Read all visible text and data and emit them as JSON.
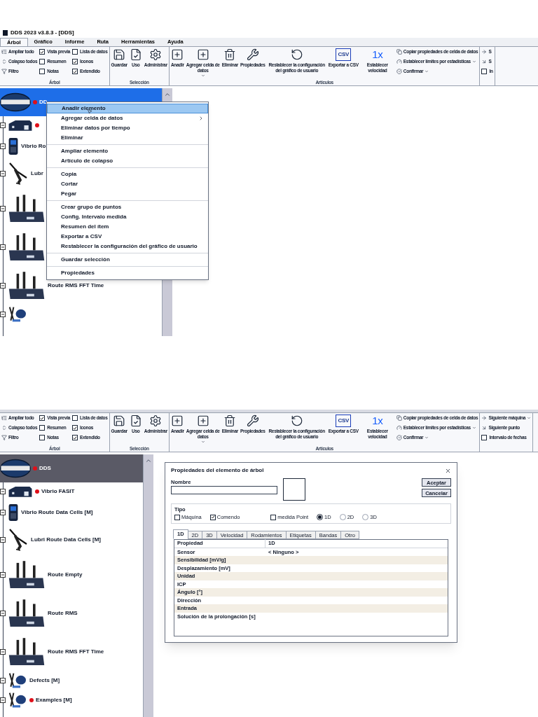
{
  "screens": [
    {
      "title": "DDS 2023 v3.8.3 - [DDS]",
      "tabs": [
        {
          "label": "Árbol",
          "selected": true
        },
        {
          "label": "Gráfico",
          "selected": false
        },
        {
          "label": "Informe",
          "selected": false
        },
        {
          "label": "Ruta",
          "selected": false
        },
        {
          "label": "Herramientas",
          "selected": false
        },
        {
          "label": "Ayuda",
          "selected": false
        }
      ],
      "ribbon": [
        {
          "label": "Árbol",
          "columns": [
            [
              {
                "kind": "small",
                "label": "Ampliar todo"
              },
              {
                "kind": "small",
                "label": "Colapso todos"
              },
              {
                "kind": "small",
                "label": "Filtro"
              }
            ],
            [
              {
                "kind": "check",
                "label": "Vista previa",
                "checked": true
              },
              {
                "kind": "check",
                "label": "Resumen",
                "checked": false
              },
              {
                "kind": "check",
                "label": "Notas",
                "checked": false
              }
            ],
            [
              {
                "kind": "check",
                "label": "Lista de datos",
                "checked": false
              },
              {
                "kind": "check",
                "label": "Iconos",
                "checked": true
              },
              {
                "kind": "check",
                "label": "Extendido",
                "checked": true
              }
            ]
          ]
        },
        {
          "label": "Selección",
          "columns": [
            [
              {
                "kind": "large",
                "label": "Guardar"
              }
            ],
            [
              {
                "kind": "large",
                "label": "Uso"
              }
            ],
            [
              {
                "kind": "large",
                "label": "Administrar"
              }
            ]
          ]
        },
        {
          "label": "Artículos",
          "columns": [
            [
              {
                "kind": "large",
                "label": "Anadir"
              }
            ],
            [
              {
                "kind": "large",
                "label": "Agregar celda de datos",
                "menu": true
              }
            ],
            [
              {
                "kind": "large",
                "label": "Eliminar"
              }
            ],
            [
              {
                "kind": "large",
                "label": "Propiedades"
              }
            ],
            [
              {
                "kind": "large",
                "label": "Restablecer la configuración del gráfico de usuario"
              }
            ],
            [
              {
                "kind": "large",
                "label": "Exportar a CSV",
                "glyph": "CSV"
              }
            ],
            [
              {
                "kind": "large",
                "label": "Establecer velocidad",
                "glyph": "1x"
              }
            ],
            [
              {
                "kind": "small",
                "label": "Copiar propiedades de celda de datos"
              },
              {
                "kind": "small",
                "label": "Establecer límites por estadísticas",
                "menu": true
              },
              {
                "kind": "small",
                "label": "Confirmar",
                "menu": true
              }
            ]
          ]
        },
        {
          "columns": [
            [
              {
                "kind": "small",
                "label": "S"
              },
              {
                "kind": "small",
                "label": "S"
              },
              {
                "kind": "check",
                "label": "In",
                "checked": false
              }
            ]
          ]
        }
      ],
      "tree_focused": true,
      "tree": [
        {
          "kind": "root",
          "label": "DD",
          "alarm": true,
          "selected": true
        },
        {
          "kind": "building",
          "alarm": true,
          "selected": false
        },
        {
          "kind": "device",
          "label": "Vibrio Ro",
          "alarm": false,
          "selected": false
        },
        {
          "kind": "lubricator",
          "label": "Lubr",
          "alarm": false,
          "selected": false
        },
        {
          "kind": "router",
          "alarm": false,
          "selected": false
        },
        {
          "kind": "router",
          "alarm": false,
          "selected": false
        },
        {
          "kind": "router",
          "label": "Route RMS FFT Time",
          "alarm": false,
          "selected": false
        },
        {
          "kind": "defects",
          "alarm": false,
          "selected": false
        }
      ],
      "context_menu": [
        [
          {
            "label": "Anadir elemento",
            "highlighted": true,
            "submenu": false
          },
          {
            "label": "Agregar celda de datos",
            "highlighted": false,
            "submenu": true
          },
          {
            "label": "Eliminar datos por tiempo",
            "highlighted": false,
            "submenu": false
          },
          {
            "label": "Eliminar",
            "highlighted": false,
            "submenu": false
          }
        ],
        [
          {
            "label": "Ampliar elemento",
            "highlighted": false,
            "submenu": false
          },
          {
            "label": "Artículo de colapso",
            "highlighted": false,
            "submenu": false
          }
        ],
        [
          {
            "label": "Copia",
            "highlighted": false,
            "submenu": false
          },
          {
            "label": "Cortar",
            "highlighted": false,
            "submenu": false
          },
          {
            "label": "Pegar",
            "highlighted": false,
            "submenu": false
          }
        ],
        [
          {
            "label": "Crear grupo de puntos",
            "highlighted": false,
            "submenu": false
          },
          {
            "label": "Config. Intervalo medida",
            "highlighted": false,
            "submenu": false
          },
          {
            "label": "Resumen del ítem",
            "highlighted": false,
            "submenu": false
          },
          {
            "label": "Exportar a CSV",
            "highlighted": false,
            "submenu": false
          },
          {
            "label": "Restablecer la configuración del gráfico de usuario",
            "highlighted": false,
            "submenu": false
          }
        ],
        [
          {
            "label": "Guardar selección",
            "highlighted": false,
            "submenu": false
          }
        ],
        [
          {
            "label": "Propiedades",
            "highlighted": false,
            "submenu": false
          }
        ]
      ]
    },
    {
      "ribbon": [
        {
          "label": "Árbol",
          "columns": [
            [
              {
                "kind": "small",
                "label": "Ampliar todo"
              },
              {
                "kind": "small",
                "label": "Colapso todos"
              },
              {
                "kind": "small",
                "label": "Filtro"
              }
            ],
            [
              {
                "kind": "check",
                "label": "Vista previa",
                "checked": true
              },
              {
                "kind": "check",
                "label": "Resumen",
                "checked": false
              },
              {
                "kind": "check",
                "label": "Notas",
                "checked": false
              }
            ],
            [
              {
                "kind": "check",
                "label": "Lista de datos",
                "checked": false
              },
              {
                "kind": "check",
                "label": "Iconos",
                "checked": true
              },
              {
                "kind": "check",
                "label": "Extendido",
                "checked": true
              }
            ]
          ]
        },
        {
          "label": "Selección",
          "columns": [
            [
              {
                "kind": "large",
                "label": "Guardar"
              }
            ],
            [
              {
                "kind": "large",
                "label": "Uso"
              }
            ],
            [
              {
                "kind": "large",
                "label": "Administrar"
              }
            ]
          ]
        },
        {
          "label": "Artículos",
          "columns": [
            [
              {
                "kind": "large",
                "label": "Anadir"
              }
            ],
            [
              {
                "kind": "large",
                "label": "Agregar celda de datos",
                "menu": true
              }
            ],
            [
              {
                "kind": "large",
                "label": "Eliminar"
              }
            ],
            [
              {
                "kind": "large",
                "label": "Propiedades"
              }
            ],
            [
              {
                "kind": "large",
                "label": "Restablecer la configuración del gráfico de usuario"
              }
            ],
            [
              {
                "kind": "large",
                "label": "Exportar a CSV",
                "glyph": "CSV"
              }
            ],
            [
              {
                "kind": "large",
                "label": "Establecer velocidad",
                "glyph": "1x"
              }
            ],
            [
              {
                "kind": "small",
                "label": "Copiar propiedades de celda de datos"
              },
              {
                "kind": "small",
                "label": "Establecer límites por estadísticas",
                "menu": true
              },
              {
                "kind": "small",
                "label": "Confirmar",
                "menu": true
              }
            ]
          ]
        },
        {
          "columns": [
            [
              {
                "kind": "small",
                "label": "Siguiente máquina",
                "menu": true
              },
              {
                "kind": "small",
                "label": "Siguiente punto"
              },
              {
                "kind": "check",
                "label": "Intervalo de fechas",
                "checked": false
              }
            ]
          ]
        }
      ],
      "tree_focused": false,
      "tree": [
        {
          "kind": "root",
          "label": "DDS",
          "alarm": true,
          "selected": true
        },
        {
          "kind": "building",
          "label": "Vibrio FASIT",
          "alarm": true,
          "selected": false
        },
        {
          "kind": "device",
          "label": "Vibrio Route Data Cells [M]",
          "alarm": false,
          "selected": false
        },
        {
          "kind": "lubricator",
          "label": "Lubri Route Data Cells [M]",
          "alarm": false,
          "selected": false
        },
        {
          "kind": "router",
          "label": "Route Empty",
          "alarm": false,
          "selected": false
        },
        {
          "kind": "router",
          "label": "Route RMS",
          "alarm": false,
          "selected": false
        },
        {
          "kind": "router",
          "label": "Route RMS FFT Time",
          "alarm": false,
          "selected": false
        },
        {
          "kind": "defects",
          "label": "Defects [M]",
          "alarm": false,
          "selected": false
        },
        {
          "kind": "defects",
          "label": "Examples [M]",
          "alarm": true,
          "selected": false
        }
      ],
      "dialog": {
        "title": "Propiedades del elemento de árbol",
        "name_label": "Nombre",
        "buttons": [
          "Aceptar",
          "Cancelar"
        ],
        "type_label": "Tipo",
        "checks": [
          {
            "label": "Máquina",
            "checked": false
          },
          {
            "label": "Comendo",
            "checked": true
          },
          {
            "label": "medida Point",
            "checked": false
          }
        ],
        "radios": [
          {
            "label": "1D",
            "selected": true
          },
          {
            "label": "2D",
            "selected": false
          },
          {
            "label": "3D",
            "selected": false
          }
        ],
        "tabs": [
          {
            "label": "1D",
            "selected": true
          },
          {
            "label": "2D",
            "selected": false
          },
          {
            "label": "3D",
            "selected": false
          },
          {
            "label": "Velocidad",
            "selected": false
          },
          {
            "label": "Rodamientos",
            "selected": false
          },
          {
            "label": "Etiquetas",
            "selected": false
          },
          {
            "label": "Bandas",
            "selected": false
          },
          {
            "label": "Otro",
            "selected": false
          }
        ],
        "grid_header": [
          "Propiedad",
          "1D"
        ],
        "rows": [
          {
            "property": "Sensor",
            "value": "< Ninguno >"
          },
          {
            "property": "Sensibilidad [mV/g]"
          },
          {
            "property": "Desplazamiento [mV]"
          },
          {
            "property": "Unidad"
          },
          {
            "property": "ICP"
          },
          {
            "property": "Ángulo [°]"
          },
          {
            "property": "Dirección"
          },
          {
            "property": "Entrada"
          },
          {
            "property": "Solución de la prolongación [s]"
          }
        ]
      }
    }
  ]
}
